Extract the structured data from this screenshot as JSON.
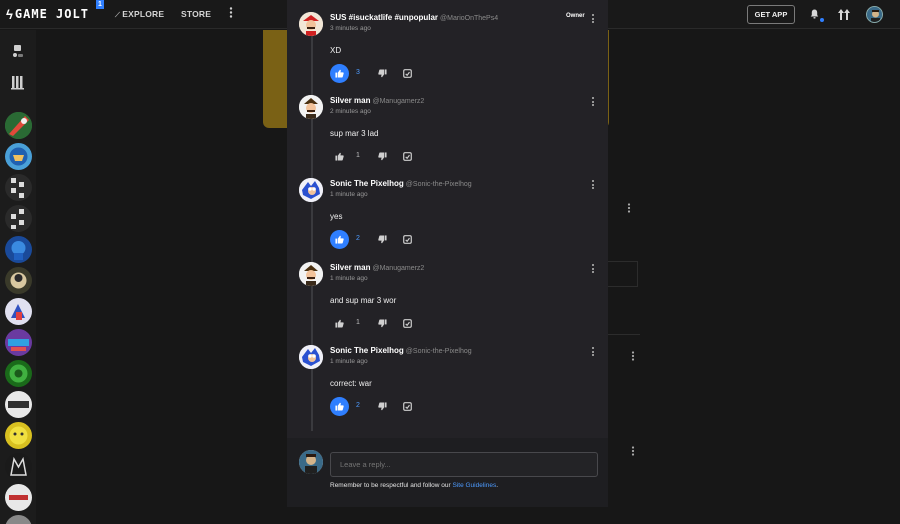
{
  "nav": {
    "logo_text": "GAME JOLT",
    "badge": "1",
    "explore": "EXPLORE",
    "store": "STORE",
    "get_app": "GET APP"
  },
  "comments": [
    {
      "name": "SUS #isuckatlife #unpopular",
      "handle": "@MarioOnThePs4",
      "time": "3 minutes ago",
      "text": "XD",
      "likes": "3",
      "liked": true,
      "owner": "Owner",
      "avatar": "mario-avatar"
    },
    {
      "name": "Silver man",
      "handle": "@Manugamerz2",
      "time": "2 minutes ago",
      "text": "sup mar 3 lad",
      "likes": "1",
      "liked": false,
      "avatar": "mario-avatar"
    },
    {
      "name": "Sonic The Pixelhog",
      "handle": "@Sonic-the-Pixelhog",
      "time": "1 minute ago",
      "text": "yes",
      "likes": "2",
      "liked": true,
      "avatar": "sonic-avatar"
    },
    {
      "name": "Silver man",
      "handle": "@Manugamerz2",
      "time": "1 minute ago",
      "text": "and sup mar 3 wor",
      "likes": "1",
      "liked": false,
      "avatar": "mario-avatar"
    },
    {
      "name": "Sonic The Pixelhog",
      "handle": "@Sonic-the-Pixelhog",
      "time": "1 minute ago",
      "text": "correct: war",
      "likes": "2",
      "liked": true,
      "avatar": "sonic-avatar"
    }
  ],
  "reply": {
    "placeholder": "Leave a reply...",
    "guidelines_prefix": "Remember to be respectful and follow our ",
    "guidelines_link": "Site Guidelines",
    "guidelines_suffix": "."
  },
  "colors": {
    "accent": "#2f7fff",
    "modal_bg": "#232226",
    "page_bg": "#171717"
  }
}
